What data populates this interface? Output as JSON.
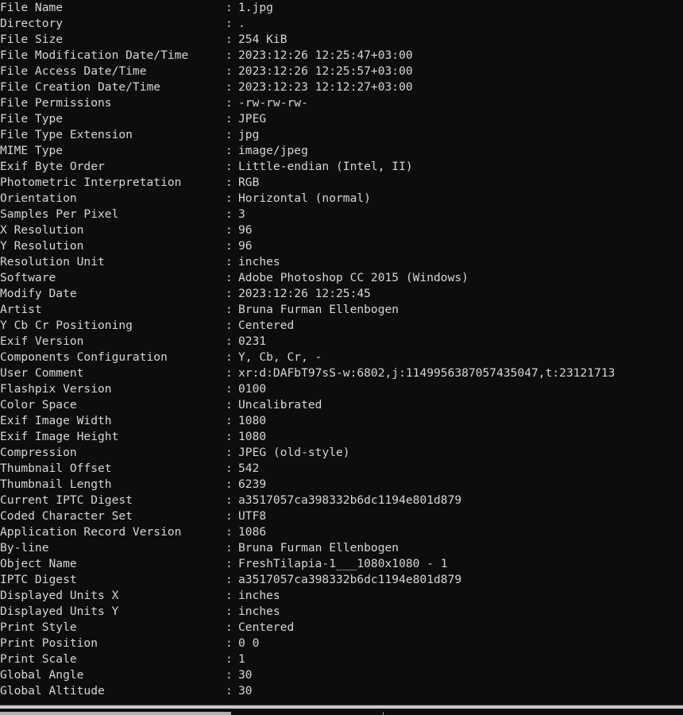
{
  "terminal": {
    "tool": "exiftool",
    "separator": ":",
    "background_color": "#0d0d0d",
    "text_color": "#d6d6d6",
    "rows": [
      {
        "label": "File Name",
        "value": "1.jpg"
      },
      {
        "label": "Directory",
        "value": "."
      },
      {
        "label": "File Size",
        "value": "254 KiB"
      },
      {
        "label": "File Modification Date/Time",
        "value": "2023:12:26 12:25:47+03:00"
      },
      {
        "label": "File Access Date/Time",
        "value": "2023:12:26 12:25:57+03:00"
      },
      {
        "label": "File Creation Date/Time",
        "value": "2023:12:23 12:12:27+03:00"
      },
      {
        "label": "File Permissions",
        "value": "-rw-rw-rw-"
      },
      {
        "label": "File Type",
        "value": "JPEG"
      },
      {
        "label": "File Type Extension",
        "value": "jpg"
      },
      {
        "label": "MIME Type",
        "value": "image/jpeg"
      },
      {
        "label": "Exif Byte Order",
        "value": "Little-endian (Intel, II)"
      },
      {
        "label": "Photometric Interpretation",
        "value": "RGB"
      },
      {
        "label": "Orientation",
        "value": "Horizontal (normal)"
      },
      {
        "label": "Samples Per Pixel",
        "value": "3"
      },
      {
        "label": "X Resolution",
        "value": "96"
      },
      {
        "label": "Y Resolution",
        "value": "96"
      },
      {
        "label": "Resolution Unit",
        "value": "inches"
      },
      {
        "label": "Software",
        "value": "Adobe Photoshop CC 2015 (Windows)"
      },
      {
        "label": "Modify Date",
        "value": "2023:12:26 12:25:45"
      },
      {
        "label": "Artist",
        "value": "Bruna Furman Ellenbogen"
      },
      {
        "label": "Y Cb Cr Positioning",
        "value": "Centered"
      },
      {
        "label": "Exif Version",
        "value": "0231"
      },
      {
        "label": "Components Configuration",
        "value": "Y, Cb, Cr, -"
      },
      {
        "label": "User Comment",
        "value": "xr:d:DAFbT97sS-w:6802,j:1149956387057435047,t:23121713"
      },
      {
        "label": "Flashpix Version",
        "value": "0100"
      },
      {
        "label": "Color Space",
        "value": "Uncalibrated"
      },
      {
        "label": "Exif Image Width",
        "value": "1080"
      },
      {
        "label": "Exif Image Height",
        "value": "1080"
      },
      {
        "label": "Compression",
        "value": "JPEG (old-style)"
      },
      {
        "label": "Thumbnail Offset",
        "value": "542"
      },
      {
        "label": "Thumbnail Length",
        "value": "6239"
      },
      {
        "label": "Current IPTC Digest",
        "value": "a3517057ca398332b6dc1194e801d879"
      },
      {
        "label": "Coded Character Set",
        "value": "UTF8"
      },
      {
        "label": "Application Record Version",
        "value": "1086"
      },
      {
        "label": "By-line",
        "value": "Bruna Furman Ellenbogen"
      },
      {
        "label": "Object Name",
        "value": "FreshTilapia-1___1080x1080 - 1"
      },
      {
        "label": "IPTC Digest",
        "value": "a3517057ca398332b6dc1194e801d879"
      },
      {
        "label": "Displayed Units X",
        "value": "inches"
      },
      {
        "label": "Displayed Units Y",
        "value": "inches"
      },
      {
        "label": "Print Style",
        "value": "Centered"
      },
      {
        "label": "Print Position",
        "value": "0 0"
      },
      {
        "label": "Print Scale",
        "value": "1"
      },
      {
        "label": "Global Angle",
        "value": "30"
      },
      {
        "label": "Global Altitude",
        "value": "30"
      }
    ]
  }
}
